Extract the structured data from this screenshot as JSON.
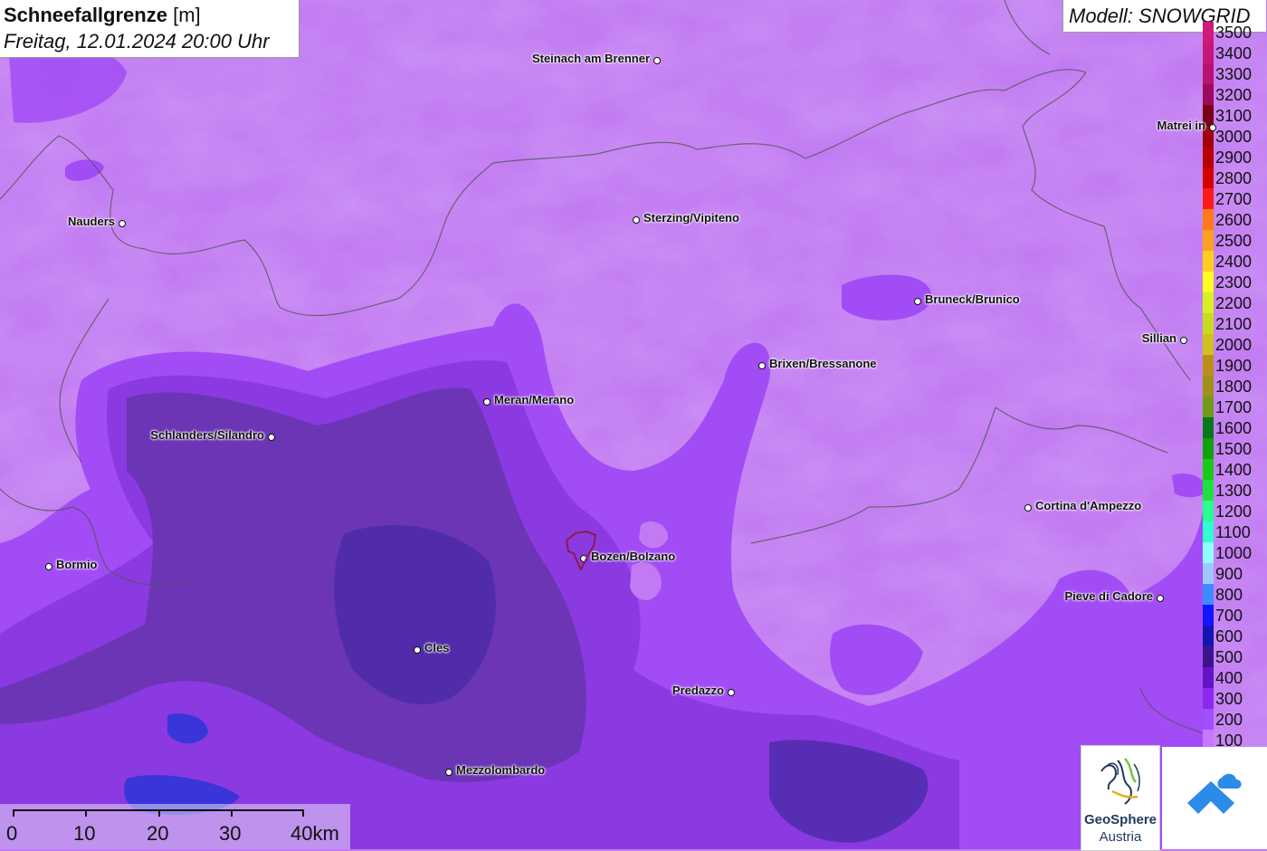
{
  "header": {
    "title_bold": "Schneefallgrenze",
    "title_unit": "[m]",
    "datetime": "Freitag, 12.01.2024 20:00 Uhr"
  },
  "model": {
    "label": "Modell: SNOWGRID"
  },
  "legend": {
    "levels": [
      {
        "label": "3500",
        "color": "#d11a7c"
      },
      {
        "label": "3400",
        "color": "#c71678"
      },
      {
        "label": "3300",
        "color": "#b81270"
      },
      {
        "label": "3200",
        "color": "#9c0a5c"
      },
      {
        "label": "3100",
        "color": "#7a0016"
      },
      {
        "label": "3000",
        "color": "#a0000e"
      },
      {
        "label": "2900",
        "color": "#b80000"
      },
      {
        "label": "2800",
        "color": "#d40000"
      },
      {
        "label": "2700",
        "color": "#ff1a1a"
      },
      {
        "label": "2600",
        "color": "#ff7a1a"
      },
      {
        "label": "2500",
        "color": "#ffa020"
      },
      {
        "label": "2400",
        "color": "#ffcc20"
      },
      {
        "label": "2300",
        "color": "#ffff20"
      },
      {
        "label": "2200",
        "color": "#d8f020"
      },
      {
        "label": "2100",
        "color": "#c8dc20"
      },
      {
        "label": "2000",
        "color": "#d0c020"
      },
      {
        "label": "1900",
        "color": "#b89018"
      },
      {
        "label": "1800",
        "color": "#a09018"
      },
      {
        "label": "1700",
        "color": "#6e9a18"
      },
      {
        "label": "1600",
        "color": "#087818"
      },
      {
        "label": "1500",
        "color": "#10a010"
      },
      {
        "label": "1400",
        "color": "#1ac81a"
      },
      {
        "label": "1300",
        "color": "#20e040"
      },
      {
        "label": "1200",
        "color": "#28ff90"
      },
      {
        "label": "1100",
        "color": "#30ffd0"
      },
      {
        "label": "1000",
        "color": "#90ffff"
      },
      {
        "label": "900",
        "color": "#a0c8ff"
      },
      {
        "label": "800",
        "color": "#3c8cff"
      },
      {
        "label": "700",
        "color": "#1414ff"
      },
      {
        "label": "600",
        "color": "#1414b0"
      },
      {
        "label": "500",
        "color": "#3c1488"
      },
      {
        "label": "400",
        "color": "#6414c8"
      },
      {
        "label": "300",
        "color": "#8c28f0"
      },
      {
        "label": "200",
        "color": "#a050ff"
      },
      {
        "label": "100",
        "color": "#c878ff"
      }
    ]
  },
  "cities": [
    {
      "name": "Steinach am Brenner",
      "side": "left"
    },
    {
      "name": "Nauders",
      "side": "left"
    },
    {
      "name": "Sterzing/Vipiteno",
      "side": "right"
    },
    {
      "name": "Bruneck/Brunico",
      "side": "right"
    },
    {
      "name": "Brixen/Bressanone",
      "side": "right"
    },
    {
      "name": "Meran/Merano",
      "side": "right"
    },
    {
      "name": "Schlanders/Silandro",
      "side": "left"
    },
    {
      "name": "Sillian",
      "side": "left"
    },
    {
      "name": "Matrei in",
      "side": "left"
    },
    {
      "name": "Cortina d'Ampezzo",
      "side": "right"
    },
    {
      "name": "Bozen/Bolzano",
      "side": "right"
    },
    {
      "name": "Bormio",
      "side": "right"
    },
    {
      "name": "Pieve di Cadore",
      "side": "left"
    },
    {
      "name": "Cles",
      "side": "right"
    },
    {
      "name": "Predazzo",
      "side": "left"
    },
    {
      "name": "Mezzolombardo",
      "side": "right"
    }
  ],
  "scalebar": {
    "labels": [
      "0",
      "10",
      "20",
      "30",
      "40km"
    ]
  },
  "logos": {
    "geosphere_name": "GeoSphere",
    "geosphere_sub": "Austria"
  },
  "colors": {
    "base_snowline": "#c17af2",
    "band_300": "#a24cf5",
    "band_400": "#8a3ae0",
    "band_500": "#6b35b5",
    "band_600": "#4a2aa8",
    "band_700": "#3a35d8",
    "border_line": "#555555",
    "city_marker_bolzano": "#8b1a3a"
  }
}
